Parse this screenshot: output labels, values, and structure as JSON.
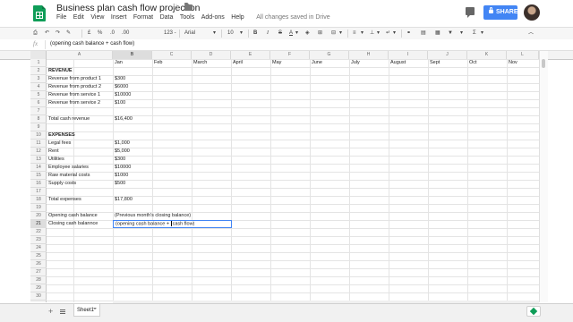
{
  "doc": {
    "title": "Business plan cash flow projection",
    "menus": [
      "File",
      "Edit",
      "View",
      "Insert",
      "Format",
      "Data",
      "Tools",
      "Add-ons",
      "Help"
    ],
    "saved_status": "All changes saved in Drive",
    "share_label": "SHARE"
  },
  "toolbar": {
    "currency": "£",
    "percent": "%",
    "decimal_less": ".0",
    "decimal_more": ".00",
    "more_formats": "123 -",
    "font": "Arial",
    "font_size": "10",
    "bold": "B",
    "italic": "I",
    "strike": "S",
    "text_color": "A"
  },
  "formula_bar": {
    "fx": "fx",
    "value": "(opening cash balance + cash flow)"
  },
  "columns": [
    "A",
    "B",
    "C",
    "D",
    "E",
    "F",
    "G",
    "H",
    "I",
    "J",
    "K",
    "L"
  ],
  "rows": [
    "1",
    "2",
    "3",
    "4",
    "5",
    "6",
    "7",
    "8",
    "9",
    "10",
    "11",
    "12",
    "13",
    "14",
    "15",
    "16",
    "17",
    "18",
    "19",
    "20",
    "21",
    "22",
    "23",
    "24",
    "25",
    "26",
    "27",
    "28",
    "29",
    "30"
  ],
  "cells": {
    "months": [
      "Jan",
      "Feb",
      "March",
      "April",
      "May",
      "June",
      "July",
      "August",
      "Sept",
      "Oct",
      "Nov"
    ],
    "revenue_header": "REVENUE",
    "rev_p1_label": "Revenue from product 1",
    "rev_p1_value": "$300",
    "rev_p2_label": "Revenue from product 2",
    "rev_p2_value": "$6000",
    "rev_s1_label": "Revenue from service 1",
    "rev_s1_value": "$10000",
    "rev_s2_label": "Revenue from service 2",
    "rev_s2_value": "$100",
    "total_rev_label": "Total cash revenue",
    "total_rev_value": "$16,400",
    "expenses_header": "EXPENSES",
    "legal_label": "Legal fees",
    "legal_value": "$1,000",
    "rent_label": "Rent",
    "rent_value": "$5,000",
    "utilities_label": "Utilities",
    "utilities_value": "$300",
    "salaries_label": "Employee salaries",
    "salaries_value": "$10000",
    "raw_label": "Raw material costs",
    "raw_value": "$1000",
    "supply_label": "Supply costs",
    "supply_value": "$500",
    "total_exp_label": "Total expenses",
    "total_exp_value": "$17,800",
    "opening_label": "Opening cash balance",
    "opening_value": "(Previous month's closing balance)",
    "closing_label": "Closing cash balannce",
    "closing_value_before_caret": "(opening cash balance + ",
    "closing_value_after_caret": "cash flow)"
  },
  "sheets": [
    "Sheet1"
  ]
}
